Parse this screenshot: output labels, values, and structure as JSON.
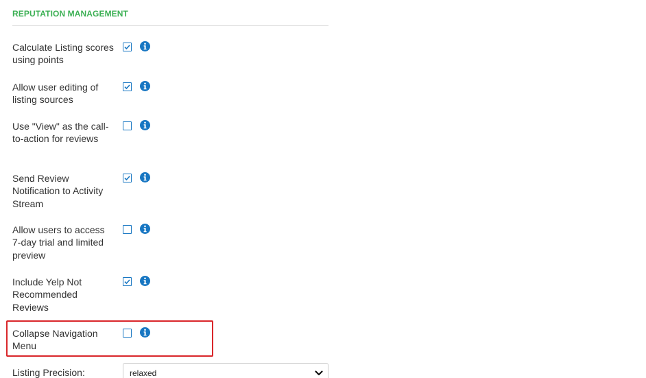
{
  "section": {
    "title": "REPUTATION MANAGEMENT"
  },
  "settings": [
    {
      "label": "Calculate Listing scores using points",
      "checked": true
    },
    {
      "label": "Allow user editing of listing sources",
      "checked": true
    },
    {
      "label": "Use \"View\" as the call-to-action for reviews",
      "checked": false
    },
    {
      "label": "Send Review Notification to Activity Stream",
      "checked": true
    },
    {
      "label": "Allow users to access 7-day trial and limited preview",
      "checked": false
    },
    {
      "label": "Include Yelp Not Recommended Reviews",
      "checked": true
    },
    {
      "label": "Collapse Navigation Menu",
      "checked": false
    }
  ],
  "precision": {
    "label": "Listing Precision:",
    "value": "relaxed"
  },
  "colors": {
    "section_title": "#3cb054",
    "accent": "#1776c2",
    "highlight": "#d9262a"
  },
  "icons": {
    "info": "info-icon",
    "check": "check-icon",
    "dropdown": "chevron-down-icon"
  }
}
